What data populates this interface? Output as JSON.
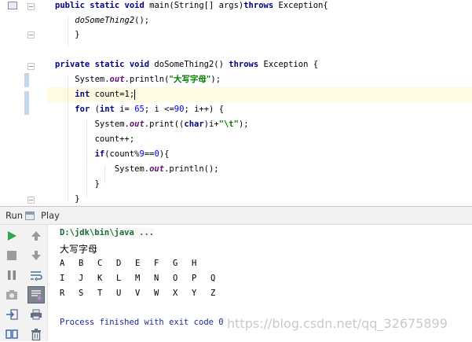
{
  "editor": {
    "lines": [
      {
        "parts": [
          {
            "t": "public static void",
            "c": "kw"
          },
          {
            "t": " main(String[] args)"
          },
          {
            "t": "throws",
            "c": "kw"
          },
          {
            "t": " Exception{"
          }
        ]
      },
      {
        "parts": [
          {
            "t": "    "
          },
          {
            "t": "doSomeThing2",
            "c": "mth"
          },
          {
            "t": "();"
          }
        ]
      },
      {
        "parts": [
          {
            "t": "    }"
          }
        ]
      },
      {
        "parts": []
      },
      {
        "parts": [
          {
            "t": "private static void",
            "c": "kw"
          },
          {
            "t": " doSomeThing2() "
          },
          {
            "t": "throws",
            "c": "kw"
          },
          {
            "t": " Exception {"
          }
        ]
      },
      {
        "parts": [
          {
            "t": "    System."
          },
          {
            "t": "out",
            "c": "fld"
          },
          {
            "t": ".println("
          },
          {
            "t": "\"大写字母\"",
            "c": "str"
          },
          {
            "t": ");"
          }
        ]
      },
      {
        "parts": [
          {
            "t": "    "
          },
          {
            "t": "int",
            "c": "kw"
          },
          {
            "t": " count=1;"
          }
        ],
        "active": true,
        "caret": true
      },
      {
        "parts": [
          {
            "t": "    "
          },
          {
            "t": "for",
            "c": "kw"
          },
          {
            "t": " ("
          },
          {
            "t": "int",
            "c": "kw"
          },
          {
            "t": " i= "
          },
          {
            "t": "65",
            "c": "num"
          },
          {
            "t": "; i <="
          },
          {
            "t": "90",
            "c": "num"
          },
          {
            "t": "; i++) {"
          }
        ]
      },
      {
        "parts": [
          {
            "t": "        System."
          },
          {
            "t": "out",
            "c": "fld"
          },
          {
            "t": ".print(("
          },
          {
            "t": "char",
            "c": "kw"
          },
          {
            "t": ")i+"
          },
          {
            "t": "\"\\t\"",
            "c": "str"
          },
          {
            "t": ");"
          }
        ]
      },
      {
        "parts": [
          {
            "t": "        count++;"
          }
        ]
      },
      {
        "parts": [
          {
            "t": "        "
          },
          {
            "t": "if",
            "c": "kw"
          },
          {
            "t": "(count%"
          },
          {
            "t": "9",
            "c": "num"
          },
          {
            "t": "=="
          },
          {
            "t": "0",
            "c": "num"
          },
          {
            "t": "){"
          }
        ]
      },
      {
        "parts": [
          {
            "t": "            System."
          },
          {
            "t": "out",
            "c": "fld"
          },
          {
            "t": ".println();"
          }
        ]
      },
      {
        "parts": [
          {
            "t": "        }"
          }
        ]
      },
      {
        "parts": [
          {
            "t": "    }"
          }
        ]
      }
    ]
  },
  "run_panel": {
    "tab_label": "Run",
    "config_label": "Play"
  },
  "toolbar": {
    "icons": [
      "rerun-icon",
      "stop-icon",
      "pause-icon",
      "camera-icon",
      "exit-icon",
      "scroll-up-icon",
      "scroll-down-icon",
      "soft-wrap-icon",
      "scroll-to-end-icon",
      "print-icon",
      "trash-icon",
      "layout-icon"
    ]
  },
  "console": {
    "path": "D:\\jdk\\bin\\java ...",
    "heading": "大写字母",
    "rows": [
      [
        "A",
        "B",
        "C",
        "D",
        "E",
        "F",
        "G",
        "H"
      ],
      [
        "I",
        "J",
        "K",
        "L",
        "M",
        "N",
        "O",
        "P",
        "Q"
      ],
      [
        "R",
        "S",
        "T",
        "U",
        "V",
        "W",
        "X",
        "Y",
        "Z"
      ]
    ],
    "exit_message": "Process finished with exit code 0",
    "watermark": "https://blog.csdn.net/qq_32675899"
  }
}
